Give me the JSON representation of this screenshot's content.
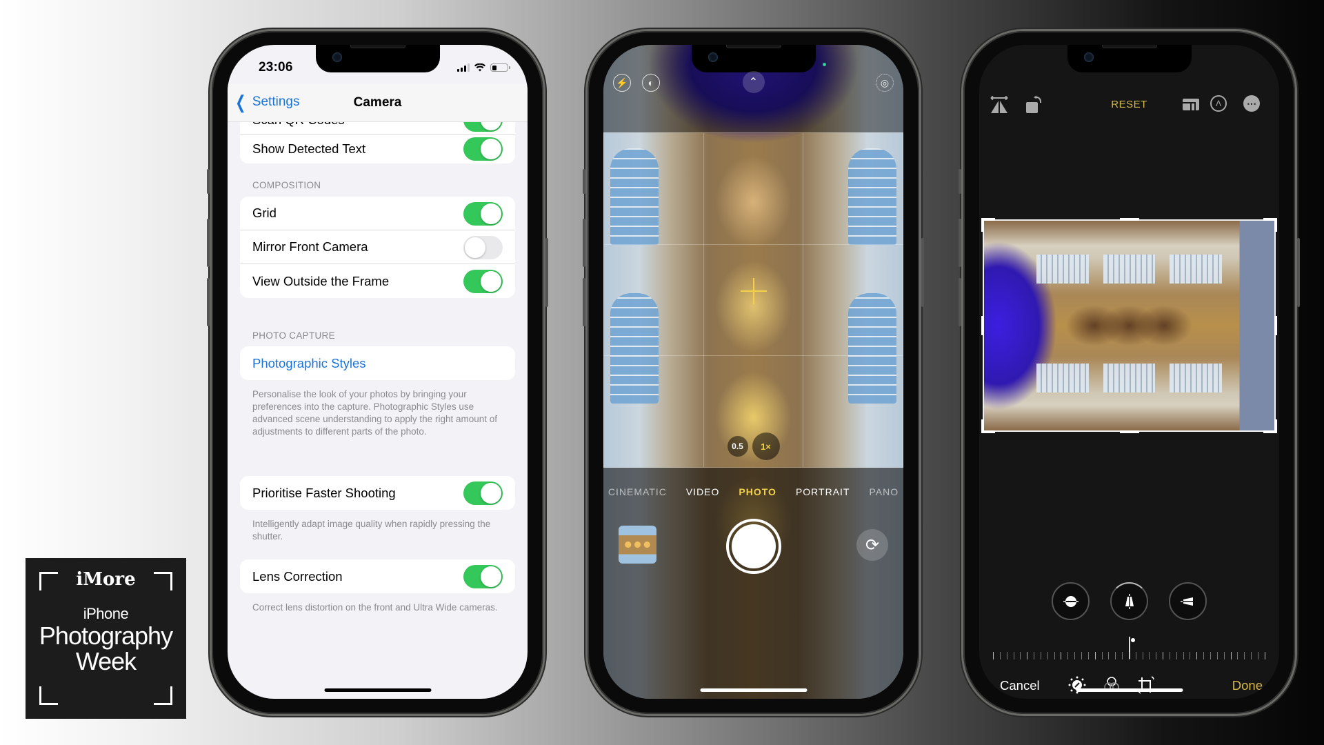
{
  "logo": {
    "brand": "iMore",
    "subtitle": "iPhone",
    "title_line1": "Photography",
    "title_line2": "Week"
  },
  "settings_phone": {
    "status": {
      "time": "23:06",
      "battery_level": 0.3
    },
    "nav": {
      "back_label": "Settings",
      "title": "Camera"
    },
    "group1": [
      {
        "label": "Scan QR Codes",
        "on": true
      },
      {
        "label": "Show Detected Text",
        "on": true
      }
    ],
    "composition": {
      "header": "COMPOSITION",
      "rows": [
        {
          "label": "Grid",
          "on": true
        },
        {
          "label": "Mirror Front Camera",
          "on": false
        },
        {
          "label": "View Outside the Frame",
          "on": true
        }
      ]
    },
    "photo_capture": {
      "header": "PHOTO CAPTURE",
      "styles_link": "Photographic Styles",
      "styles_footnote": "Personalise the look of your photos by bringing your preferences into the capture. Photographic Styles use advanced scene understanding to apply the right amount of adjustments to different parts of the photo.",
      "faster": {
        "label": "Prioritise Faster Shooting",
        "on": true
      },
      "faster_footnote": "Intelligently adapt image quality when rapidly pressing the shutter."
    },
    "lens": {
      "label": "Lens Correction",
      "on": true,
      "footnote": "Correct lens distortion on the front and Ultra Wide cameras."
    }
  },
  "camera_phone": {
    "icons": [
      "flash-off-icon",
      "night-mode-icon",
      "chevron-up-icon",
      "live-photo-off-icon"
    ],
    "zoom_levels": [
      "0.5",
      "1×"
    ],
    "active_zoom": "1×",
    "modes": [
      "CINEMATIC",
      "VIDEO",
      "PHOTO",
      "PORTRAIT",
      "PANO"
    ],
    "active_mode": "PHOTO",
    "accent": "#f3d24a"
  },
  "editor_phone": {
    "reset_label": "RESET",
    "cancel_label": "Cancel",
    "done_label": "Done",
    "perspective_tools": [
      "straighten",
      "vertical",
      "horizontal"
    ],
    "active_perspective": "vertical",
    "straighten_value": 0,
    "bottom_tools": [
      "adjust",
      "filters",
      "crop"
    ],
    "active_tool": "crop",
    "accent": "#d7b94a"
  }
}
